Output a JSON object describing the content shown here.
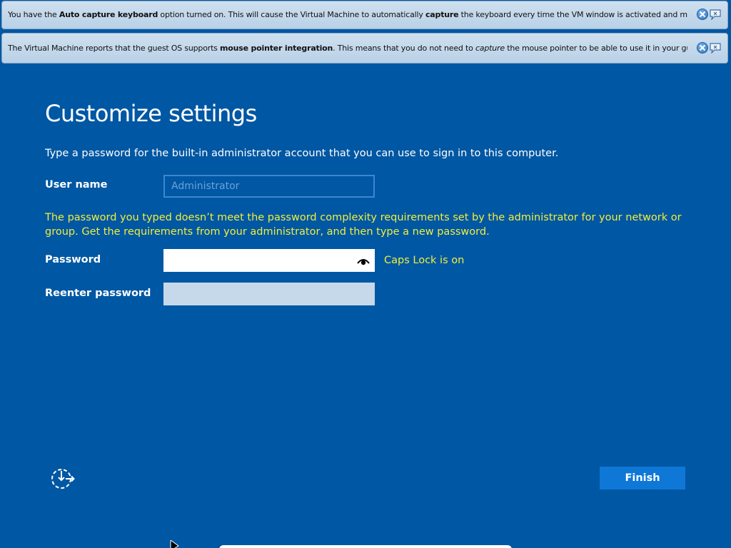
{
  "notifications": [
    {
      "text_before": "You have the ",
      "bold1": "Auto capture keyboard",
      "text_mid": " option turned on. This will cause the Virtual Machine to automatically ",
      "bold2": "capture",
      "text_after": " the keyboard every time the VM window is activated and make it unavailable to"
    },
    {
      "text_before": "The Virtual Machine reports that the guest OS supports ",
      "bold1": "mouse pointer integration",
      "text_mid": ". This means that you do not need to ",
      "italic": "capture",
      "text_after": " the mouse pointer to be able to use it in your guest OS -- all mouse"
    }
  ],
  "page": {
    "title": "Customize settings",
    "instructions": "Type a password for the built-in administrator account that you can use to sign in to this computer.",
    "user_label": "User name",
    "user_placeholder": "Administrator",
    "error": "The password you typed doesn’t meet the password complexity requirements set by the administrator for your network or group. Get the requirements from your administrator, and then type a new password.",
    "password_label": "Password",
    "password_value": "",
    "capslock": "Caps Lock is on",
    "reenter_label": "Reenter password",
    "reenter_value": "",
    "finish_label": "Finish"
  },
  "colors": {
    "background": "#0057a3",
    "warning": "#f0ef3c",
    "finish_button": "#0f78d7"
  },
  "icons": {
    "close": "close-circle-icon",
    "help": "speech-bubble-icon",
    "reveal": "eye-icon",
    "ease_of_access": "ease-of-access-icon"
  }
}
